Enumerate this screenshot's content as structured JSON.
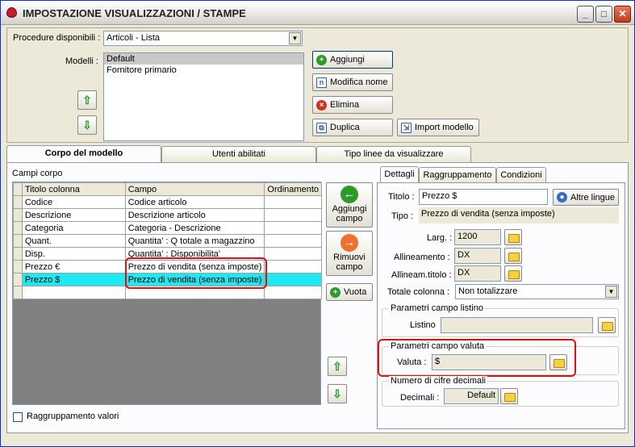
{
  "window": {
    "title": "IMPOSTAZIONE VISUALIZZAZIONI / STAMPE",
    "min": "_",
    "max": "□",
    "close": "✕"
  },
  "top": {
    "procedure_label": "Procedure disponibili :",
    "procedure_value": "Articoli - Lista",
    "modelli_label": "Modelli :",
    "modelli": [
      "Default",
      "Fornitore primario"
    ],
    "buttons": {
      "aggiungi": "Aggiungi",
      "modifica": "Modifica nome",
      "elimina": "Elimina",
      "duplica": "Duplica",
      "import": "Import modello"
    }
  },
  "tabs": [
    "Corpo del modello",
    "Utenti abilitati",
    "Tipo linee da visualizzare"
  ],
  "campi_corpo_label": "Campi corpo",
  "grid": {
    "headers": [
      "Titolo colonna",
      "Campo",
      "Ordinamento"
    ],
    "rows": [
      [
        "Codice",
        "Codice articolo",
        ""
      ],
      [
        "Descrizione",
        "Descrizione articolo",
        ""
      ],
      [
        "Categoria",
        "Categoria - Descrizione",
        ""
      ],
      [
        "Quant.",
        "Quantita' : Q totale a magazzino",
        ""
      ],
      [
        "Disp.",
        "Quantita' : Disponibilita'",
        ""
      ],
      [
        "Prezzo €",
        "Prezzo di vendita (senza imposte)",
        ""
      ],
      [
        "Prezzo $",
        "Prezzo di vendita (senza imposte)",
        ""
      ]
    ]
  },
  "mid_buttons": {
    "aggiungi_campo": [
      "Aggiungi",
      "campo"
    ],
    "rimuovi_campo": [
      "Rimuovi",
      "campo"
    ],
    "vuota": "Vuota"
  },
  "raggruppamento_valori": "Raggruppamento valori",
  "inner_tabs": [
    "Dettagli",
    "Raggruppamento",
    "Condizioni"
  ],
  "details": {
    "titolo_label": "Titolo :",
    "titolo_value": "Prezzo $",
    "altre_lingue": "Altre lingue",
    "tipo_label": "Tipo :",
    "tipo_value": "Prezzo di vendita (senza imposte)",
    "larg_label": "Larg. :",
    "larg_value": "1200",
    "allineamento_label": "Allineamento :",
    "allineamento_value": "DX",
    "allineam_titolo_label": "Allineam.titolo :",
    "allineam_titolo_value": "DX",
    "totale_label": "Totale colonna :",
    "totale_value": "Non totalizzare",
    "listino_group": "Parametri campo listino",
    "listino_label": "Listino",
    "valuta_group": "Parametri campo valuta",
    "valuta_label": "Valuta :",
    "valuta_value": "$",
    "decimali_group": "Numero di cifre decimali",
    "decimali_label": "Decimali :",
    "decimali_value": "Default"
  }
}
